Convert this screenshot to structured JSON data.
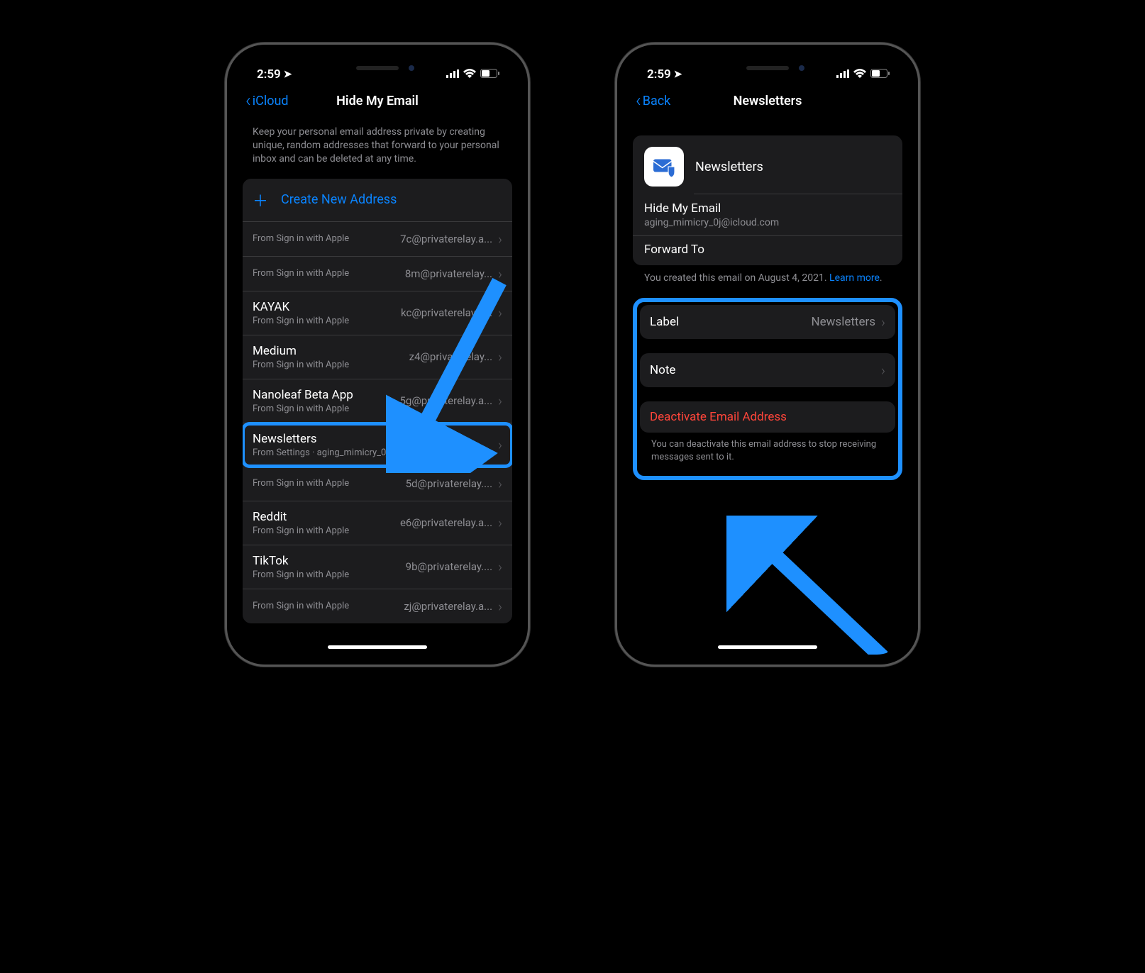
{
  "status": {
    "time": "2:59",
    "signal_label": "cellular-signal",
    "wifi_label": "wifi",
    "battery_label": "battery"
  },
  "phone1": {
    "back_label": "iCloud",
    "title": "Hide My Email",
    "description": "Keep your personal email address private by creating unique, random addresses that forward to your personal inbox and can be deleted at any time.",
    "create_label": "Create New Address",
    "items": [
      {
        "title": "",
        "sub": "From Sign in with Apple",
        "right": "7c@privaterelay.a..."
      },
      {
        "title": "",
        "sub": "From Sign in with Apple",
        "right": "8m@privaterelay..."
      },
      {
        "title": "KAYAK",
        "sub": "From Sign in with Apple",
        "right": "kc@privaterelay.a..."
      },
      {
        "title": "Medium",
        "sub": "From Sign in with Apple",
        "right": "z4@privaterelay..."
      },
      {
        "title": "Nanoleaf Beta App",
        "sub": "From Sign in with Apple",
        "right": "5g@privaterelay.a..."
      },
      {
        "title": "Newsletters",
        "sub": "From Settings · aging_mimicry_0j@icloud.com",
        "right": ""
      },
      {
        "title": "",
        "sub": "From Sign in with Apple",
        "right": "5d@privaterelay...."
      },
      {
        "title": "Reddit",
        "sub": "From Sign in with Apple",
        "right": "e6@privaterelay.a..."
      },
      {
        "title": "TikTok",
        "sub": "From Sign in with Apple",
        "right": "9b@privaterelay...."
      },
      {
        "title": "",
        "sub": "From Sign in with Apple",
        "right": "zj@privaterelay.a..."
      }
    ]
  },
  "phone2": {
    "back_label": "Back",
    "title": "Newsletters",
    "header_name": "Newsletters",
    "hide_label": "Hide My Email",
    "hide_value": "aging_mimicry_0j@icloud.com",
    "forward_label": "Forward To",
    "created_note_prefix": "You created this email on August 4, 2021. ",
    "learn_more": "Learn more",
    "period": ".",
    "label_key": "Label",
    "label_value": "Newsletters",
    "note_key": "Note",
    "deactivate_label": "Deactivate Email Address",
    "deactivate_desc": "You can deactivate this email address to stop receiving messages sent to it."
  }
}
